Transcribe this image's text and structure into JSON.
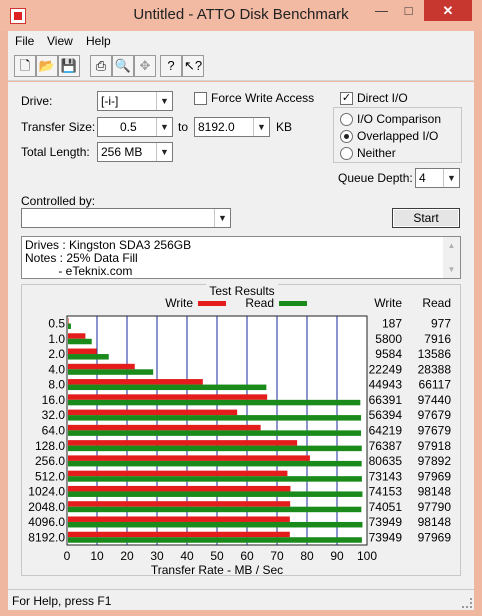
{
  "window": {
    "title": "Untitled - ATTO Disk Benchmark",
    "min": "—",
    "max": "□",
    "close": "✕"
  },
  "menu": {
    "file": "File",
    "view": "View",
    "help": "Help"
  },
  "toolbar": [
    "new-icon",
    "open-icon",
    "save-icon",
    "print-icon",
    "print-preview-icon",
    "move-icon",
    "help-icon",
    "context-help-icon"
  ],
  "form": {
    "drive_label": "Drive:",
    "drive_value": "[-i-]",
    "force_write_label": "Force Write Access",
    "force_write_checked": false,
    "direct_io_label": "Direct I/O",
    "direct_io_checked": true,
    "transfer_size_label": "Transfer Size:",
    "transfer_from": "0.5",
    "to_label": "to",
    "transfer_to": "8192.0",
    "kb_label": "KB",
    "total_length_label": "Total Length:",
    "total_length_value": "256 MB",
    "io_options": [
      {
        "label": "I/O Comparison",
        "selected": false
      },
      {
        "label": "Overlapped I/O",
        "selected": true
      },
      {
        "label": "Neither",
        "selected": false
      }
    ],
    "queue_depth_label": "Queue Depth:",
    "queue_depth_value": "4",
    "controlled_by_label": "Controlled by:",
    "controlled_by_value": "",
    "start_label": "Start"
  },
  "notes": {
    "line1": "Drives : Kingston SDA3 256GB",
    "line2": "Notes : 25% Data Fill",
    "line3": "          - eTeknix.com"
  },
  "status": {
    "text": "For Help, press F1"
  },
  "chart_data": {
    "type": "bar",
    "title": "Test Results",
    "xlabel": "Transfer Rate - MB / Sec",
    "xlim": [
      0,
      100
    ],
    "xticks": [
      0,
      10,
      20,
      30,
      40,
      50,
      60,
      70,
      80,
      90,
      100
    ],
    "categories": [
      "0.5",
      "1.0",
      "2.0",
      "4.0",
      "8.0",
      "16.0",
      "32.0",
      "64.0",
      "128.0",
      "256.0",
      "512.0",
      "1024.0",
      "2048.0",
      "4096.0",
      "8192.0"
    ],
    "series": [
      {
        "name": "Write",
        "color": "#e41c1c",
        "values": [
          187,
          5800,
          9584,
          22249,
          44943,
          66391,
          56394,
          64219,
          76387,
          80635,
          73143,
          74153,
          74051,
          73949,
          73949
        ]
      },
      {
        "name": "Read",
        "color": "#1a8a1a",
        "values": [
          977,
          7916,
          13586,
          28388,
          66117,
          97440,
          97679,
          97679,
          97918,
          97892,
          97969,
          98148,
          97790,
          98148,
          97969
        ]
      }
    ],
    "value_columns": [
      "Write",
      "Read"
    ],
    "grid": true,
    "legend": "top"
  }
}
